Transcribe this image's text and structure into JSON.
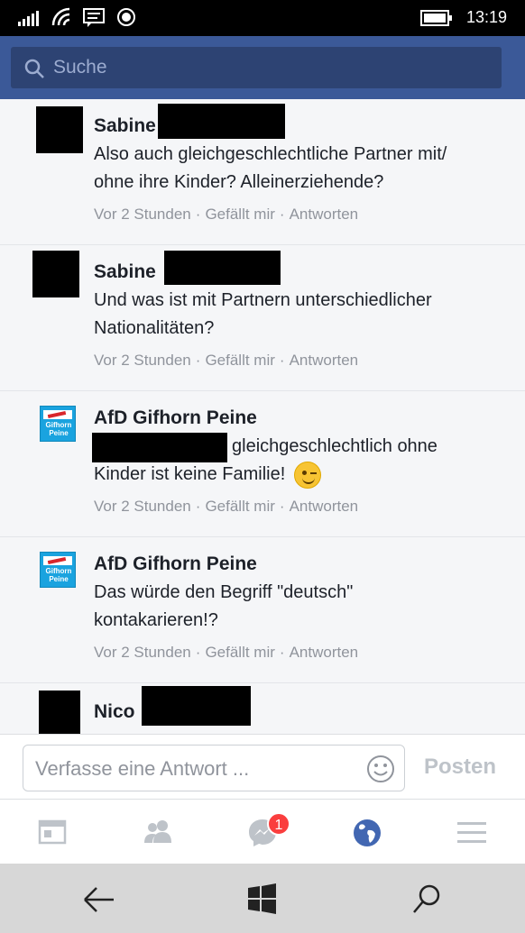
{
  "status_bar": {
    "time": "13:19"
  },
  "search": {
    "placeholder": "Suche"
  },
  "comments": [
    {
      "author": "Sabine",
      "avatar": "black",
      "lines": [
        "Also auch gleichgeschlechtliche Partner mit/",
        "ohne ihre Kinder?  Alleinerziehende?"
      ],
      "time": "Vor 2 Stunden",
      "like": "Gefällt mir",
      "reply": "Antworten"
    },
    {
      "author": "Sabine",
      "avatar": "black",
      "lines": [
        "Und was ist mit Partnern unterschiedlicher",
        "Nationalitäten?"
      ],
      "time": "Vor 2 Stunden",
      "like": "Gefällt mir",
      "reply": "Antworten"
    },
    {
      "author": "AfD Gifhorn Peine",
      "avatar": "afd-logo",
      "lines": [
        "gleichgeschlechtlich ohne",
        "Kinder ist keine Familie!"
      ],
      "time": "Vor 2 Stunden",
      "like": "Gefällt mir",
      "reply": "Antworten"
    },
    {
      "author": "AfD Gifhorn Peine",
      "avatar": "afd-logo",
      "lines": [
        "Das würde den Begriff \"deutsch\"",
        "kontakarieren!?"
      ],
      "time": "Vor 2 Stunden",
      "like": "Gefällt mir",
      "reply": "Antworten"
    },
    {
      "author": "Nico",
      "avatar": "black"
    }
  ],
  "afd_logo_text": [
    "Gifhorn",
    "Peine"
  ],
  "reply_bar": {
    "placeholder": "Verfasse eine Antwort ...",
    "post_label": "Posten"
  },
  "tabs": [
    {
      "icon": "news-feed-icon"
    },
    {
      "icon": "friends-icon"
    },
    {
      "icon": "messenger-icon",
      "badge": "1"
    },
    {
      "icon": "globe-icon",
      "active": true
    },
    {
      "icon": "menu-icon"
    }
  ],
  "colors": {
    "header": "#3b5998",
    "badge": "#fa3e3e",
    "active_tab": "#4267b2"
  }
}
